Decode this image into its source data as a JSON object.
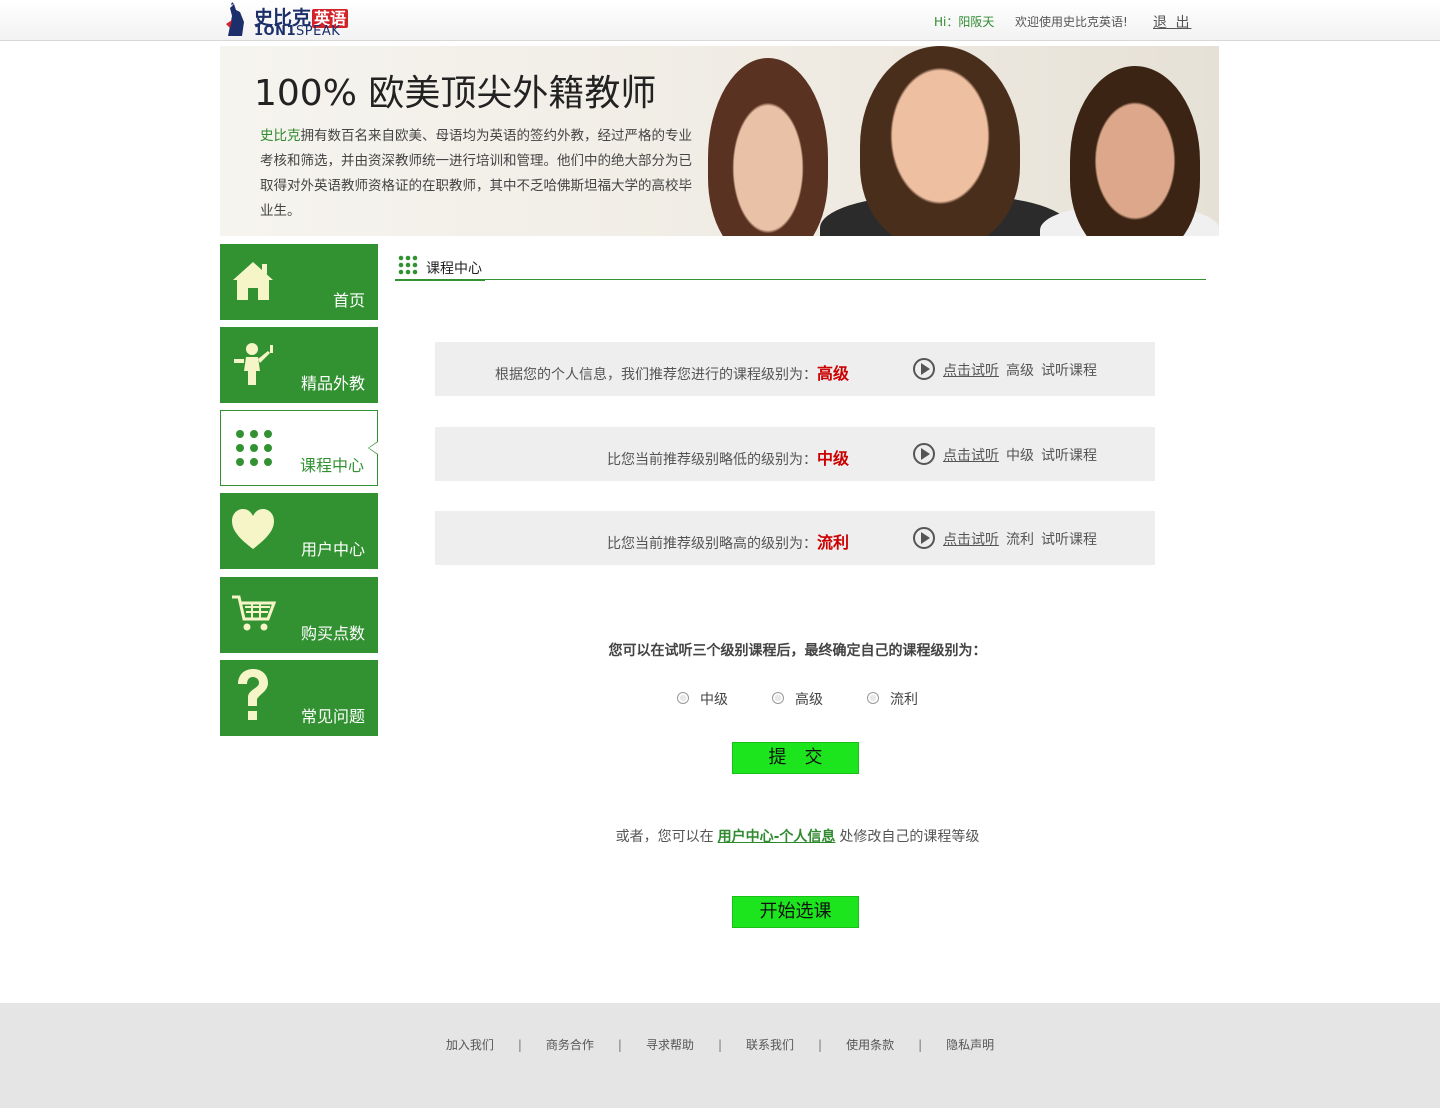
{
  "header": {
    "logo_cn": "史比克",
    "logo_tag": "英语",
    "logo_en_bold": "1ON1",
    "logo_en_light": "SPEAK",
    "greeting_prefix": "Hi：",
    "username": "阳阪天",
    "welcome": "欢迎使用史比克英语!",
    "logout": "退 出"
  },
  "banner": {
    "title": "100% 欧美顶尖外籍教师",
    "brand": "史比克",
    "text": "拥有数百名来自欧美、母语均为英语的签约外教，经过严格的专业考核和筛选，并由资深教师统一进行培训和管理。他们中的绝大部分为已取得对外英语教师资格证的在职教师，其中不乏哈佛斯坦福大学的高校毕业生。"
  },
  "sidebar": {
    "items": [
      {
        "label": "首页",
        "icon": "home-icon"
      },
      {
        "label": "精品外教",
        "icon": "teacher-icon"
      },
      {
        "label": "课程中心",
        "icon": "grid-dots-icon",
        "active": true
      },
      {
        "label": "用户中心",
        "icon": "heart-icon"
      },
      {
        "label": "购买点数",
        "icon": "cart-icon"
      },
      {
        "label": "常见问题",
        "icon": "question-icon"
      }
    ]
  },
  "content": {
    "section_title": "课程中心",
    "levels": [
      {
        "desc": "根据您的个人信息，我们推荐您进行的课程级别为：",
        "level": "高级",
        "trial_link": "点击试听",
        "trial_level": "高级",
        "trial_suffix": "试听课程"
      },
      {
        "desc": "比您当前推荐级别略低的级别为：",
        "level": "中级",
        "trial_link": "点击试听",
        "trial_level": "中级",
        "trial_suffix": "试听课程"
      },
      {
        "desc": "比您当前推荐级别略高的级别为：",
        "level": "流利",
        "trial_link": "点击试听",
        "trial_level": "流利",
        "trial_suffix": "试听课程"
      }
    ],
    "final_question": "您可以在试听三个级别课程后，最终确定自己的课程级别为：",
    "options": [
      "中级",
      "高级",
      "流利"
    ],
    "submit": "提　交",
    "or_prefix": "或者，您可以在",
    "or_link": "用户中心-个人信息",
    "or_suffix": "处修改自己的课程等级",
    "start": "开始选课"
  },
  "footer": {
    "links": [
      "加入我们",
      "商务合作",
      "寻求帮助",
      "联系我们",
      "使用条款",
      "隐私声明"
    ],
    "separator": "|"
  },
  "colors": {
    "brand_green": "#329232",
    "button_green": "#1de51d",
    "level_red": "#cc0000",
    "row_bg": "#eeeeee",
    "footer_bg": "#e5e5e5"
  }
}
